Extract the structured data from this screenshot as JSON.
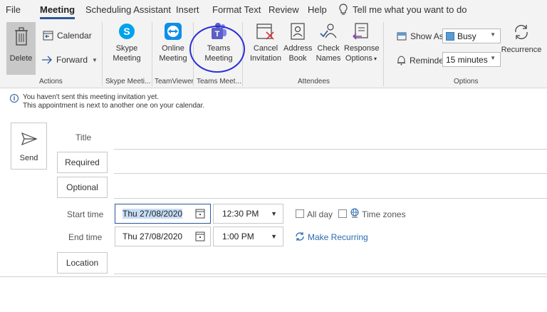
{
  "menu": {
    "tabs": [
      "File",
      "Meeting",
      "Scheduling Assistant",
      "Insert",
      "Format Text",
      "Review",
      "Help"
    ],
    "active_tab": "Meeting",
    "tell_me": "Tell me what you want to do"
  },
  "ribbon": {
    "actions": {
      "delete": "Delete",
      "calendar": "Calendar",
      "forward": "Forward",
      "group_label": "Actions"
    },
    "skype": {
      "line1": "Skype",
      "line2": "Meeting",
      "group_label": "Skype Meeti..."
    },
    "teamviewer": {
      "line1": "Online",
      "line2": "Meeting",
      "group_label": "TeamViewer"
    },
    "teams": {
      "line1": "Teams",
      "line2": "Meeting",
      "group_label": "Teams Meet..."
    },
    "attendees": {
      "cancel": {
        "line1": "Cancel",
        "line2": "Invitation"
      },
      "address": {
        "line1": "Address",
        "line2": "Book"
      },
      "check": {
        "line1": "Check",
        "line2": "Names"
      },
      "response": {
        "line1": "Response",
        "line2": "Options"
      },
      "group_label": "Attendees"
    },
    "options": {
      "show_as_label": "Show As:",
      "show_as_value": "Busy",
      "reminder_label": "Reminder:",
      "reminder_value": "15 minutes",
      "recurrence": "Recurrence",
      "group_label": "Options"
    }
  },
  "info": {
    "line1": "You haven't sent this meeting invitation yet.",
    "line2": "This appointment is next to another one on your calendar."
  },
  "form": {
    "send": "Send",
    "title_label": "Title",
    "required": "Required",
    "optional": "Optional",
    "start_label": "Start time",
    "start_date": "Thu 27/08/2020",
    "start_time": "12:30 PM",
    "all_day": "All day",
    "time_zones": "Time zones",
    "end_label": "End time",
    "end_date": "Thu 27/08/2020",
    "end_time": "1:00 PM",
    "make_recurring": "Make Recurring",
    "location": "Location"
  },
  "colors": {
    "accent": "#2b579a",
    "skype": "#00a2ed",
    "teams": "#5b5fc7",
    "teamviewer": "#0e8ee9",
    "annotation_circle": "#2c2fd6",
    "busy": "#5b9bd5"
  }
}
